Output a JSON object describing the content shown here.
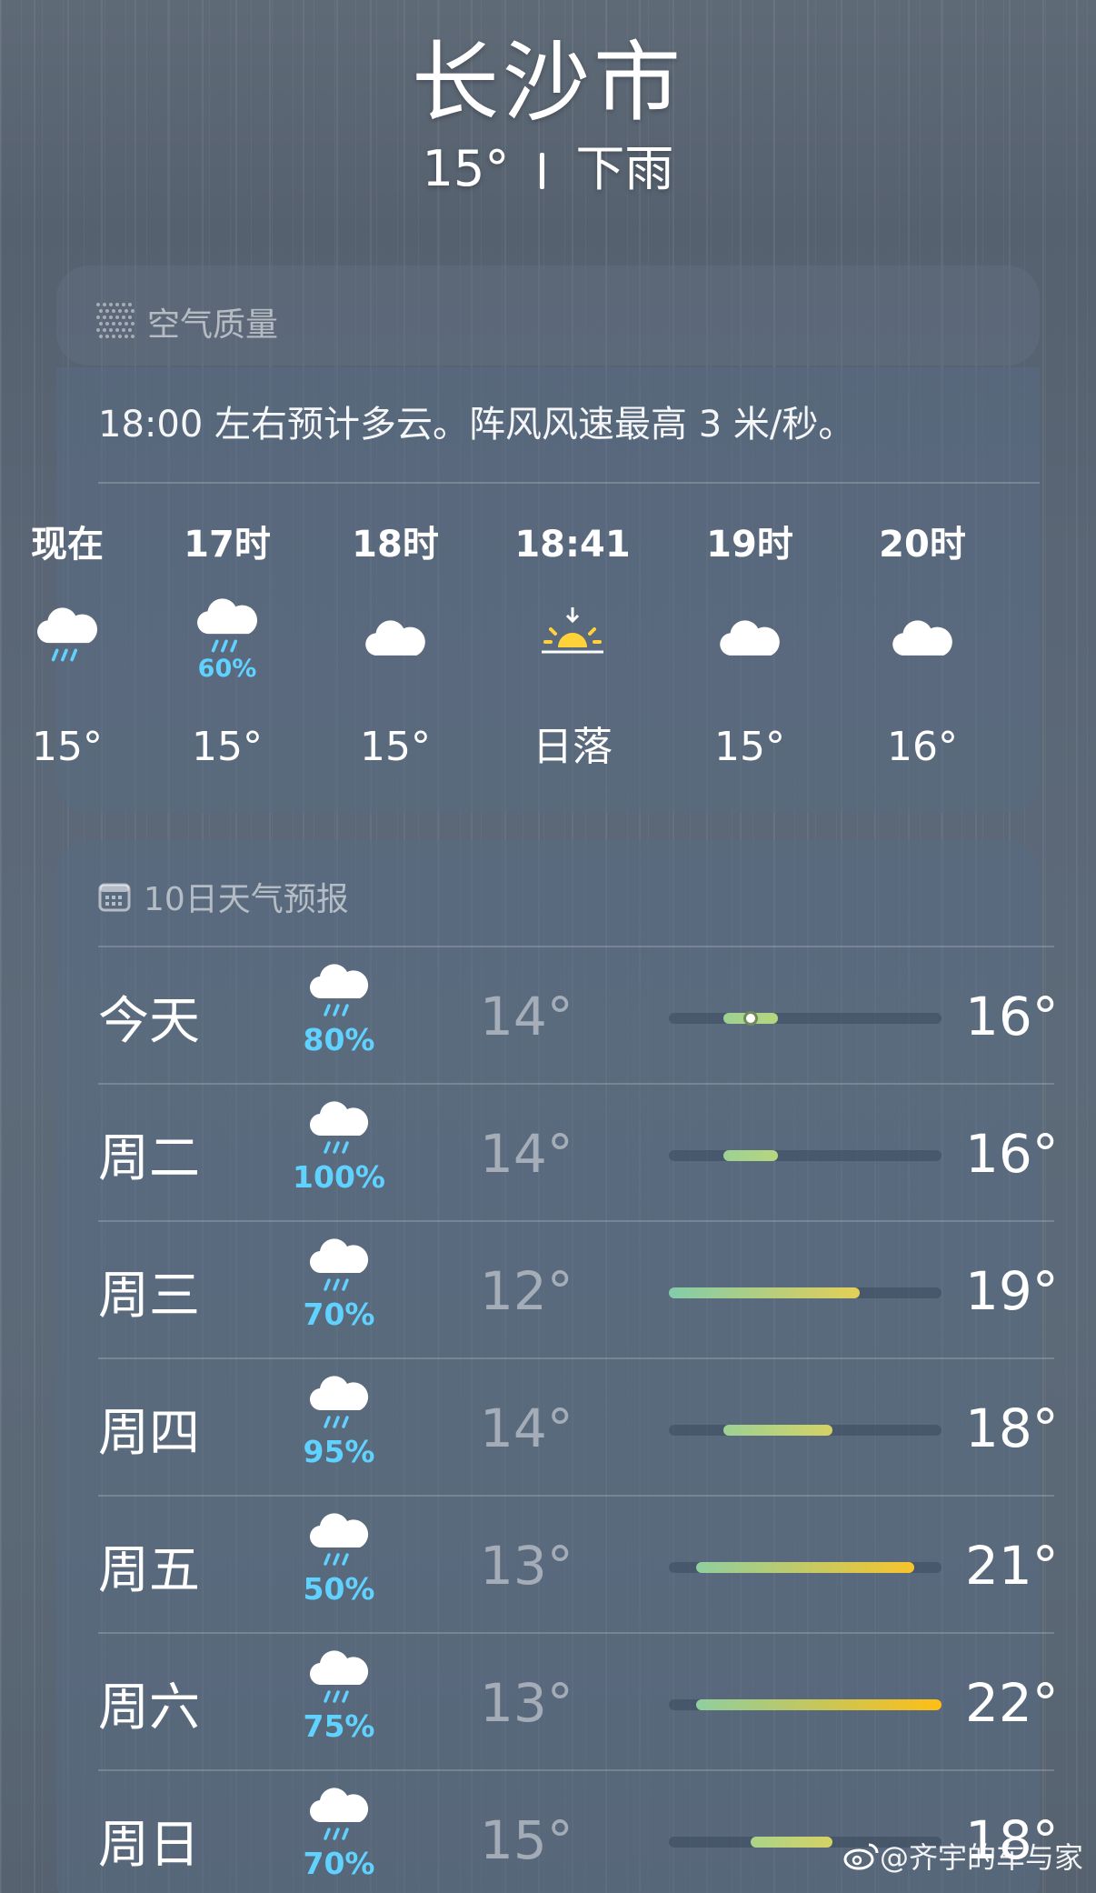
{
  "header": {
    "city": "长沙市",
    "temp": "15°",
    "condition": "下雨"
  },
  "air_quality": {
    "label": "空气质量"
  },
  "hourly": {
    "summary": "18:00 左右预计多云。阵风风速最高 3 米/秒。",
    "items": [
      {
        "time": "现在",
        "icon": "cloud-rain-icon",
        "pct": "",
        "temp": "15°"
      },
      {
        "time": "17时",
        "icon": "cloud-rain-icon",
        "pct": "60%",
        "temp": "15°"
      },
      {
        "time": "18时",
        "icon": "cloud-icon",
        "pct": "",
        "temp": "15°"
      },
      {
        "time": "18:41",
        "icon": "sunset-icon",
        "pct": "",
        "temp": "日落"
      },
      {
        "time": "19时",
        "icon": "cloud-icon",
        "pct": "",
        "temp": "15°"
      },
      {
        "time": "20时",
        "icon": "cloud-icon",
        "pct": "",
        "temp": "16°"
      }
    ]
  },
  "forecast": {
    "label": "10日天气预报",
    "range_min": 12,
    "range_max": 22,
    "days": [
      {
        "day": "今天",
        "pct": "80%",
        "lo": "14°",
        "hi": "16°",
        "lo_val": 14,
        "hi_val": 16,
        "current": 15
      },
      {
        "day": "周二",
        "pct": "100%",
        "lo": "14°",
        "hi": "16°",
        "lo_val": 14,
        "hi_val": 16
      },
      {
        "day": "周三",
        "pct": "70%",
        "lo": "12°",
        "hi": "19°",
        "lo_val": 12,
        "hi_val": 19
      },
      {
        "day": "周四",
        "pct": "95%",
        "lo": "14°",
        "hi": "18°",
        "lo_val": 14,
        "hi_val": 18
      },
      {
        "day": "周五",
        "pct": "50%",
        "lo": "13°",
        "hi": "21°",
        "lo_val": 13,
        "hi_val": 21
      },
      {
        "day": "周六",
        "pct": "75%",
        "lo": "13°",
        "hi": "22°",
        "lo_val": 13,
        "hi_val": 22
      },
      {
        "day": "周日",
        "pct": "70%",
        "lo": "15°",
        "hi": "18°",
        "lo_val": 15,
        "hi_val": 18
      }
    ]
  },
  "watermark": "@齐宇的车与家",
  "colors": {
    "precip": "#5fd2ff",
    "sun": "#ffd23a"
  }
}
